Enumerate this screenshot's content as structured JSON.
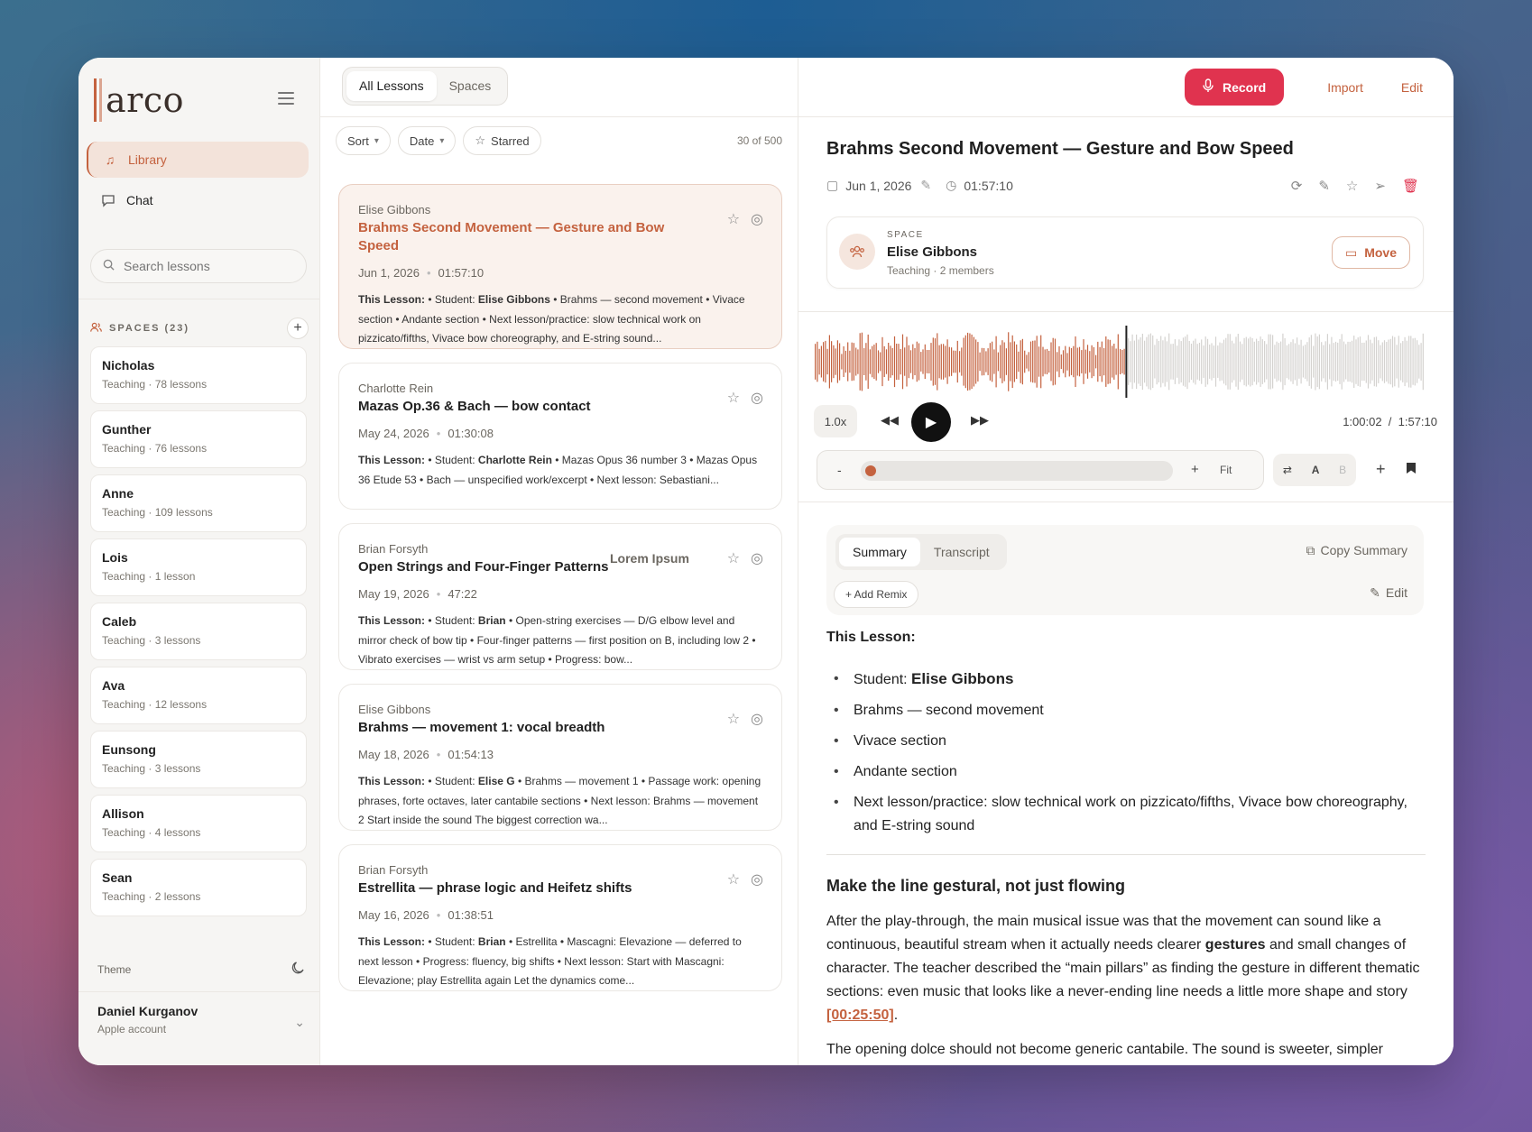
{
  "app": {
    "logo": "arco"
  },
  "colors": {
    "accent": "#c4623f",
    "record": "#e0334f"
  },
  "sidebar": {
    "nav": [
      {
        "label": "Library",
        "icon": "music-note-icon"
      },
      {
        "label": "Chat",
        "icon": "chat-bubble-icon"
      }
    ],
    "search_placeholder": "Search lessons",
    "spaces_label": "SPACES (23)",
    "spaces": [
      {
        "name": "Nicholas",
        "meta": "Teaching · 78 lessons"
      },
      {
        "name": "Gunther",
        "meta": "Teaching · 76 lessons"
      },
      {
        "name": "Anne",
        "meta": "Teaching · 109 lessons"
      },
      {
        "name": "Lois",
        "meta": "Teaching · 1 lesson"
      },
      {
        "name": "Caleb",
        "meta": "Teaching · 3 lessons"
      },
      {
        "name": "Ava",
        "meta": "Teaching · 12 lessons"
      },
      {
        "name": "Eunsong",
        "meta": "Teaching · 3 lessons"
      },
      {
        "name": "Allison",
        "meta": "Teaching · 4 lessons"
      },
      {
        "name": "Sean",
        "meta": "Teaching · 2 lessons"
      }
    ],
    "theme_label": "Theme",
    "user": {
      "name": "Daniel Kurganov",
      "account": "Apple account"
    }
  },
  "list": {
    "tabs": [
      "All Lessons",
      "Spaces"
    ],
    "filters": [
      "Sort",
      "Date",
      "Starred"
    ],
    "count": "30 of 500",
    "cards": [
      {
        "who": "Elise Gibbons",
        "title": "Brahms Second Movement — Gesture and Bow Speed",
        "date": "Jun 1, 2026",
        "dur": "01:57:10",
        "b1": "This Lesson:",
        "t1": " • Student: ",
        "b2": "Elise Gibbons",
        "t2": " • Brahms — second movement • Vivace section • Andante section • Next lesson/practice: slow technical work on pizzicato/fifths, Vivace bow choreography, and E-string sound...",
        "lorem": ""
      },
      {
        "who": "Charlotte Rein",
        "title": "Mazas Op.36 & Bach — bow contact",
        "date": "May 24, 2026",
        "dur": "01:30:08",
        "b1": "This Lesson:",
        "t1": " • Student: ",
        "b2": "Charlotte Rein",
        "t2": " • Mazas Opus 36 number 3 • Mazas Opus 36 Etude 53 • Bach — unspecified work/excerpt • Next lesson: Sebastiani...",
        "lorem": ""
      },
      {
        "who": "Brian Forsyth",
        "title": "Open Strings and Four-Finger Patterns",
        "date": "May 19, 2026",
        "dur": "47:22",
        "b1": "This Lesson:",
        "t1": " • Student: ",
        "b2": "Brian",
        "t2": " • Open-string exercises — D/G elbow level and mirror check of bow tip • Four-finger patterns — first position on B, including low 2 • Vibrato exercises — wrist vs arm setup • Progress: bow...",
        "lorem": "Lorem Ipsum"
      },
      {
        "who": "Elise Gibbons",
        "title": "Brahms — movement 1: vocal breadth",
        "date": "May 18, 2026",
        "dur": "01:54:13",
        "b1": "This Lesson:",
        "t1": " • Student: ",
        "b2": "Elise G",
        "t2": " • Brahms — movement 1 • Passage work: opening phrases, forte octaves, later cantabile sections • Next lesson: Brahms — movement 2 Start inside the sound The biggest correction wa...",
        "lorem": ""
      },
      {
        "who": "Brian Forsyth",
        "title": "Estrellita — phrase logic and Heifetz shifts",
        "date": "May 16, 2026",
        "dur": "01:38:51",
        "b1": "This Lesson:",
        "t1": " • Student: ",
        "b2": "Brian",
        "t2": " • Estrellita • Mascagni: Elevazione — deferred to next lesson • Progress: fluency, big shifts • Next lesson: Start with Mascagni: Elevazione; play Estrellita again Let the dynamics come...",
        "lorem": ""
      }
    ]
  },
  "header": {
    "record": "Record",
    "import": "Import",
    "edit": "Edit"
  },
  "detail": {
    "title": "Brahms Second Movement — Gesture and Bow Speed",
    "date": "Jun 1, 2026",
    "duration": "01:57:10",
    "space": {
      "kicker": "SPACE",
      "name": "Elise Gibbons",
      "meta": "Teaching · 2 members",
      "move": "Move"
    },
    "player": {
      "speed": "1.0x",
      "time": "1:00:02  /  1:57:10",
      "progress": 0.511,
      "zoom_minus": "-",
      "zoom_plus": "+",
      "fit": "Fit",
      "a": "A",
      "b": "B"
    },
    "summary": {
      "tabs": [
        "Summary",
        "Transcript"
      ],
      "copy": "Copy Summary",
      "remix": "+ Add Remix",
      "edit": "Edit",
      "heading": "This Lesson:",
      "student_label": "Student: ",
      "student_name": "Elise Gibbons",
      "bullets": [
        "Brahms — second movement",
        "Vivace section",
        "Andante section",
        "Next lesson/practice: slow technical work on pizzicato/fifths, Vivace bow choreography, and E-string sound"
      ],
      "section_title": "Make the line gestural, not just flowing",
      "p1": "After the play-through, the main musical issue was that the movement can sound like a continuous, beautiful stream when it actually needs clearer ",
      "p1b": "gestures",
      "p1c": " and small changes of character. The teacher described the “main pillars” as finding the gesture in different thematic sections: even music that looks like a never-ending line needs a little more shape and story ",
      "ts": "[00:25:50]",
      "p1d": ".",
      "p2": "The opening dolce should not become generic cantabile. The sound is sweeter, simpler"
    }
  }
}
